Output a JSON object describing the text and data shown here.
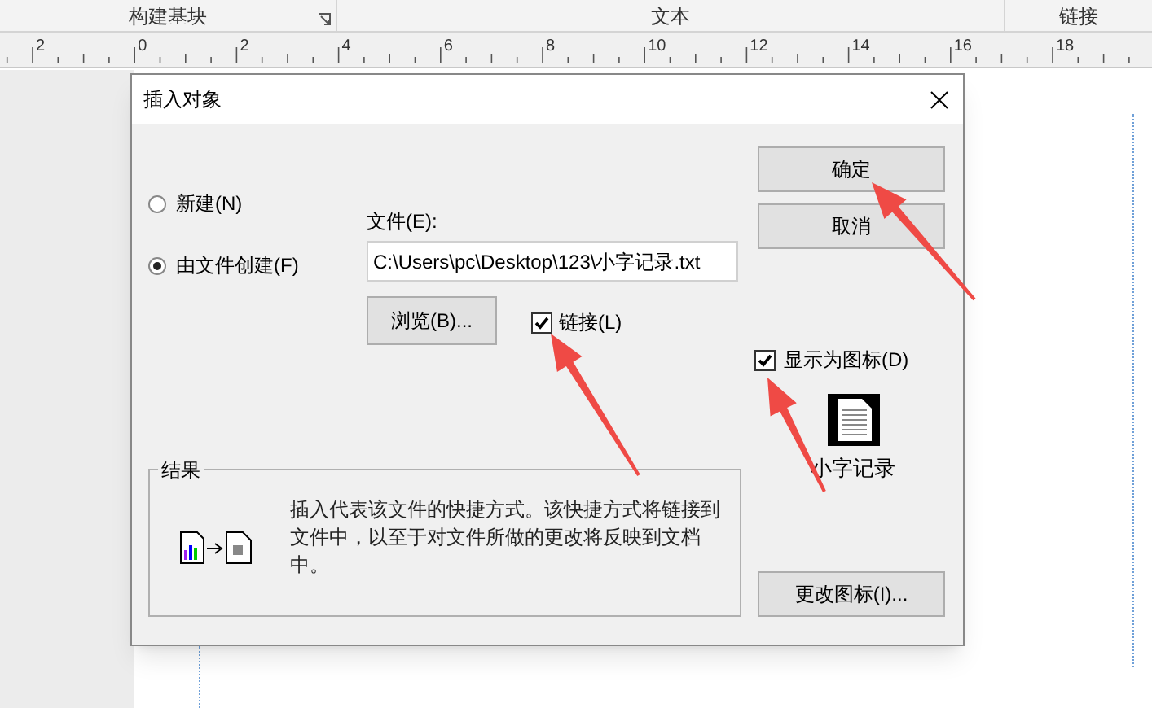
{
  "ribbon_groups": [
    "构建基块",
    "文本",
    "链接"
  ],
  "ruler": [
    "2",
    "0",
    "2",
    "4",
    "6",
    "8",
    "10",
    "12",
    "14",
    "16",
    "18"
  ],
  "dialog": {
    "title": "插入对象",
    "options": [
      {
        "label": "新建(N)",
        "selected": false
      },
      {
        "label": "由文件创建(F)",
        "selected": true
      }
    ],
    "file_label": "文件(E):",
    "file_value": "C:\\Users\\pc\\Desktop\\123\\小字记录.txt",
    "browse_button": "浏览(B)...",
    "link": {
      "label": "链接(L)",
      "checked": true
    },
    "ok_button": "确定",
    "cancel_button": "取消",
    "display_as_icon": {
      "label": "显示为图标(D)",
      "checked": true
    },
    "icon_caption": "小字记录",
    "change_icon_button": "更改图标(I)...",
    "result": {
      "legend": "结果",
      "text": "插入代表该文件的快捷方式。该快捷方式将链接到文件中，以至于对文件所做的更改将反映到文档中。"
    }
  }
}
